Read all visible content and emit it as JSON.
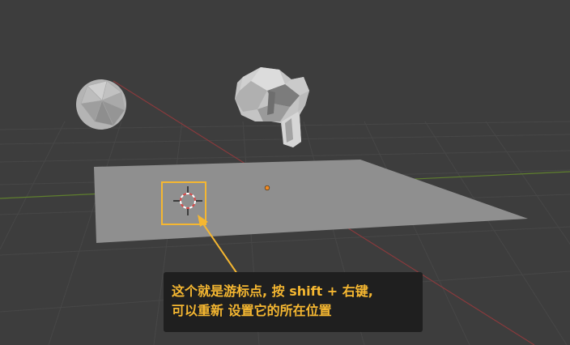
{
  "callout": {
    "line1": "这个就是游标点, 按 shift + 右键,",
    "line2": "可以重新 设置它的所在位置"
  },
  "colors": {
    "viewport_background": "#3d3d3d",
    "grid_line": "#474747",
    "x_axis": "#8a3a3d",
    "y_axis": "#5f7f2e",
    "plane_fill": "#8f8f8f",
    "highlight_box": "#f5b731",
    "callout_background": "#1f1f1f",
    "callout_text": "#f5b731",
    "origin_point": "#f08a24",
    "cursor_ring": "#d94a4a"
  },
  "scene": {
    "objects": [
      "ico-sphere",
      "monkey-head",
      "ground-plane",
      "3d-cursor",
      "object-origin"
    ]
  }
}
